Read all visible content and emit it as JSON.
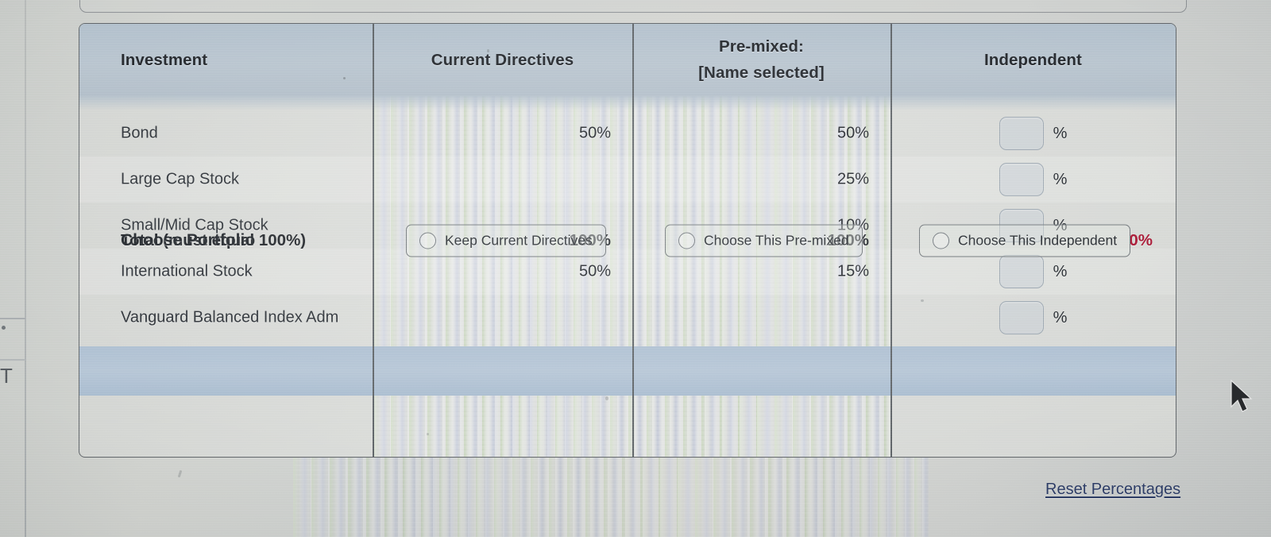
{
  "table": {
    "headers": {
      "investment": "Investment",
      "current_directives": "Current Directives",
      "premixed_line1": "Pre-mixed:",
      "premixed_line2": "[Name selected]",
      "independent": "Independent"
    },
    "rows": [
      {
        "investment": "Bond",
        "current": "50%",
        "premixed": "50%",
        "independent": "",
        "pct_sign": "%"
      },
      {
        "investment": "Large Cap Stock",
        "current": "",
        "premixed": "25%",
        "independent": "",
        "pct_sign": "%"
      },
      {
        "investment": "Small/Mid Cap Stock",
        "current": "",
        "premixed": "10%",
        "independent": "",
        "pct_sign": "%"
      },
      {
        "investment": "International Stock",
        "current": "50%",
        "premixed": "15%",
        "independent": "",
        "pct_sign": "%"
      },
      {
        "investment": "Vanguard Balanced Index Adm",
        "current": "",
        "premixed": "",
        "independent": "",
        "pct_sign": "%"
      }
    ],
    "total_row": {
      "label": "Total (must equal 100%)",
      "current": "100%",
      "premixed": "100%",
      "independent": "0%",
      "independent_color": "#a71330"
    },
    "choose_row": {
      "label": "Choose Portfolio",
      "options": [
        {
          "label": "Keep Current Directives",
          "selected": false
        },
        {
          "label": "Choose This Pre-mixed",
          "selected": false
        },
        {
          "label": "Choose This Independent",
          "selected": false
        }
      ]
    }
  },
  "footer": {
    "reset_link": "Reset Percentages",
    "reset_link_color": "#2c3c66"
  },
  "chrome": {
    "left_edge_glyph": "T"
  },
  "colors": {
    "header_band": "#b6c3ce",
    "total_band": "#b2c3d4",
    "card_border": "#63686c",
    "page_background": "#d2d4d0"
  }
}
